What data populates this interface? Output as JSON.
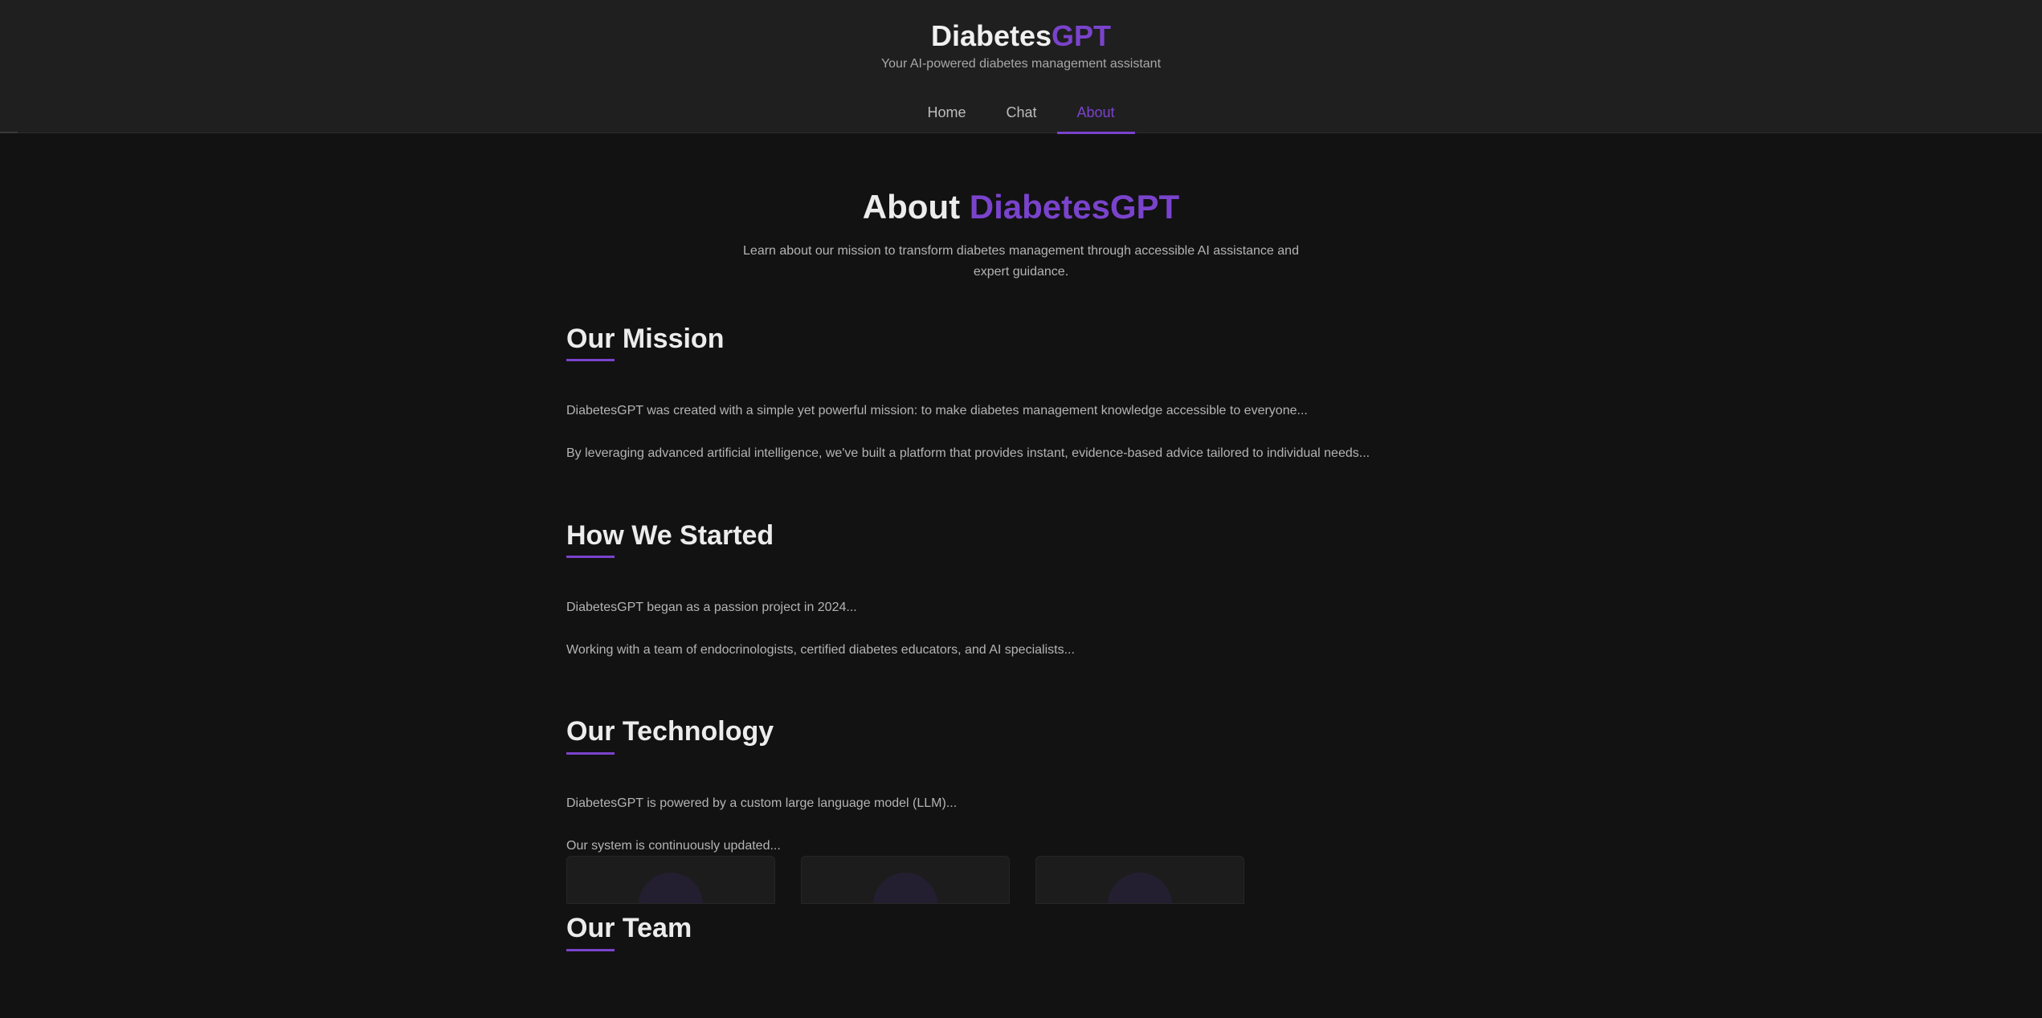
{
  "header": {
    "brand_primary": "Diabetes",
    "brand_accent": "GPT",
    "tagline": "Your AI-powered diabetes management assistant",
    "nav": [
      {
        "label": "Home",
        "active": false
      },
      {
        "label": "Chat",
        "active": false
      },
      {
        "label": "About",
        "active": true
      }
    ]
  },
  "page": {
    "title_primary": "About",
    "title_accent": "DiabetesGPT",
    "subtitle": "Learn about our mission to transform diabetes management through accessible AI assistance and expert guidance."
  },
  "sections": [
    {
      "title": "Our Mission",
      "paragraphs": [
        "DiabetesGPT was created with a simple yet powerful mission: to make diabetes management knowledge accessible to everyone...",
        "By leveraging advanced artificial intelligence, we've built a platform that provides instant, evidence-based advice tailored to individual needs..."
      ]
    },
    {
      "title": "How We Started",
      "paragraphs": [
        "DiabetesGPT began as a passion project in 2024...",
        "Working with a team of endocrinologists, certified diabetes educators, and AI specialists..."
      ]
    },
    {
      "title": "Our Technology",
      "paragraphs": [
        "DiabetesGPT is powered by a custom large language model (LLM)...",
        "Our system is continuously updated..."
      ]
    },
    {
      "title": "Our Team",
      "paragraphs": []
    }
  ],
  "colors": {
    "accent": "#7a43cc",
    "background": "#121212",
    "header_bg": "#1f1f1f"
  }
}
